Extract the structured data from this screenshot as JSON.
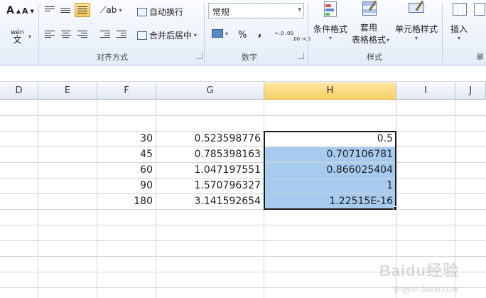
{
  "ribbon": {
    "font": {
      "grow_label": "A",
      "shrink_label": "A",
      "phonetic_label": "wén",
      "phonetic_sub": "文"
    },
    "alignment": {
      "wrap_text": "自动换行",
      "merge_center": "合并后居中",
      "group_label": "对齐方式"
    },
    "number": {
      "format_value": "常规",
      "percent": "%",
      "comma": ",",
      "inc_decimal": "←.0 .00",
      "dec_decimal": ".00 →.0",
      "group_label": "数字"
    },
    "styles": {
      "conditional": "条件格式",
      "table_fmt_line1": "套用",
      "table_fmt_line2": "表格格式",
      "cell_styles": "单元格样式",
      "group_label": "样式"
    },
    "cells": {
      "insert": "插入",
      "group_label": "单"
    }
  },
  "grid": {
    "columns": [
      "D",
      "E",
      "F",
      "G",
      "H",
      "I",
      "J"
    ],
    "active_column": "H",
    "rows": [
      {
        "f": "30",
        "g": "0.523598776",
        "h": "0.5"
      },
      {
        "f": "45",
        "g": "0.785398163",
        "h": "0.707106781"
      },
      {
        "f": "60",
        "g": "1.047197551",
        "h": "0.866025404"
      },
      {
        "f": "90",
        "g": "1.570796327",
        "h": "1"
      },
      {
        "f": "180",
        "g": "3.141592654",
        "h": "1.22515E-16"
      }
    ]
  },
  "watermark": {
    "brand": "Baidu经验",
    "url": "jingyan.baidu.com"
  },
  "colors": {
    "selection": "#a6cbef",
    "active_header": "#f7cf63",
    "ribbon_bg": "#e4ecf7"
  }
}
